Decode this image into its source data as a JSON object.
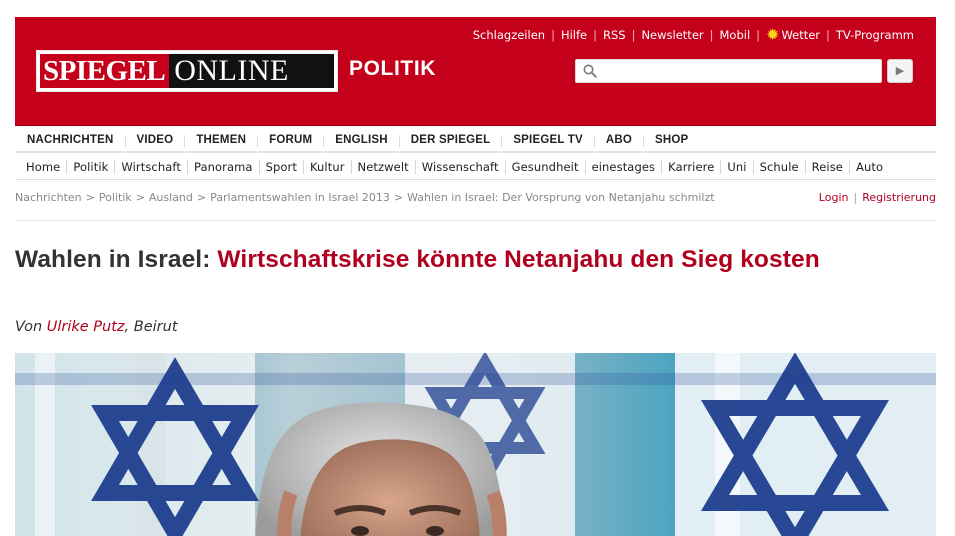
{
  "toplinks": {
    "items": [
      "Schlagzeilen",
      "Hilfe",
      "RSS",
      "Newsletter",
      "Mobil",
      "Wetter",
      "TV-Programm"
    ]
  },
  "logo": {
    "part1": "SPIEGEL",
    "part2": "ONLINE"
  },
  "section_title": "POLITIK",
  "search": {
    "value": "",
    "button_icon": "chevron-right-icon"
  },
  "mainnav": [
    "NACHRICHTEN",
    "VIDEO",
    "THEMEN",
    "FORUM",
    "ENGLISH",
    "DER SPIEGEL",
    "SPIEGEL TV",
    "ABO",
    "SHOP"
  ],
  "subnav": [
    "Home",
    "Politik",
    "Wirtschaft",
    "Panorama",
    "Sport",
    "Kultur",
    "Netzwelt",
    "Wissenschaft",
    "Gesundheit",
    "einestages",
    "Karriere",
    "Uni",
    "Schule",
    "Reise",
    "Auto"
  ],
  "breadcrumb": [
    "Nachrichten",
    "Politik",
    "Ausland",
    "Parlamentswahlen in Israel 2013",
    "Wahlen in Israel: Der Vorsprung von Netanjahu schmilzt"
  ],
  "auth": {
    "login": "Login",
    "register": "Registrierung"
  },
  "article": {
    "topic": "Wahlen in Israel:",
    "title": "Wirtschaftskrise könnte Netanjahu den Sieg kosten",
    "byline_prefix": "Von",
    "author": "Ulrike Putz",
    "location": ", Beirut"
  },
  "colors": {
    "brand_red": "#c4001a",
    "link_red": "#b1001e"
  }
}
